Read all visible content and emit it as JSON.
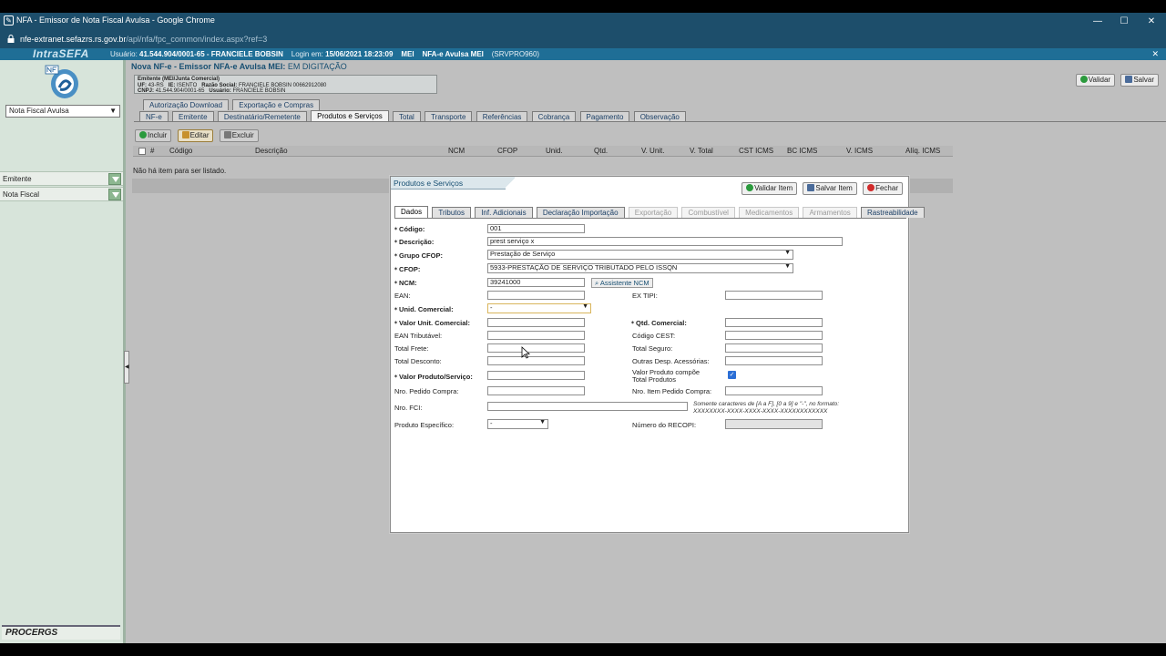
{
  "browser": {
    "window_title": "NFA - Emissor de Nota Fiscal Avulsa - Google Chrome",
    "url_host": "nfe-extranet.sefazrs.rs.gov.br",
    "url_path": "/apl/nfa/fpc_common/index.aspx?ref=3",
    "minimize": "—",
    "maximize": "☐",
    "close": "✕"
  },
  "topband": {
    "brand": "IntraSEFA",
    "user_label": "Usuário:",
    "user_value": "41.544.904/0001-65 - FRANCIELE BOBSIN",
    "login_label": "Login em:",
    "login_value": "15/06/2021 18:23:09",
    "profile1": "MEI",
    "profile2": "NFA-e Avulsa MEI",
    "server": "(SRVPRO960)",
    "close": "✕"
  },
  "sidebar": {
    "doc_type": "Nota Fiscal Avulsa",
    "items": [
      {
        "label": "Emitente"
      },
      {
        "label": "Nota Fiscal"
      }
    ],
    "footer_logo": "PROCERGS",
    "collapse": "◀"
  },
  "form": {
    "title_prefix": "Nova NF-e - Emissor NFA-e Avulsa MEI:",
    "title_status": "EM DIGITAÇÃO",
    "emitente": {
      "line1": "Emitente (MEI/Junta Comercial)",
      "uf_label": "UF:",
      "uf_value": "43-RS",
      "ie_label": "IE:",
      "ie_value": "ISENTO",
      "rs_label": "Razão Social:",
      "rs_value": "FRANCIELE BOBSIN 00662912080",
      "cnpj_label": "CNPJ:",
      "cnpj_value": "41.544.904/0001-65",
      "user_label": "Usuário:",
      "user_value": "FRANCIELE BOBSIN"
    },
    "validar": "Validar",
    "salvar": "Salvar",
    "subtabs": [
      "Autorização Download",
      "Exportação e Compras"
    ],
    "tabs": [
      "NF-e",
      "Emitente",
      "Destinatário/Remetente",
      "Produtos e Serviços",
      "Total",
      "Transporte",
      "Referências",
      "Cobrança",
      "Pagamento",
      "Observação"
    ],
    "list_actions": {
      "incluir": "Incluir",
      "editar": "Editar",
      "excluir": "Excluir"
    },
    "grid_columns": [
      "#",
      "Código",
      "Descrição",
      "NCM",
      "CFOP",
      "Unid.",
      "Qtd.",
      "V. Unit.",
      "V. Total",
      "CST ICMS",
      "BC ICMS",
      "V. ICMS",
      "Alíq. ICMS"
    ],
    "no_items": "Não há item para ser listado."
  },
  "modal": {
    "title": "Produtos e Serviços",
    "validar_item": "Validar Item",
    "salvar_item": "Salvar Item",
    "fechar": "Fechar",
    "tabs": [
      {
        "label": "Dados",
        "state": "active"
      },
      {
        "label": "Tributos",
        "state": "normal"
      },
      {
        "label": "Inf. Adicionais",
        "state": "normal"
      },
      {
        "label": "Declaração Importação",
        "state": "normal"
      },
      {
        "label": "Exportação",
        "state": "disabled"
      },
      {
        "label": "Combustível",
        "state": "disabled"
      },
      {
        "label": "Medicamentos",
        "state": "disabled"
      },
      {
        "label": "Armamentos",
        "state": "disabled"
      },
      {
        "label": "Rastreabilidade",
        "state": "normal"
      }
    ],
    "fields": {
      "codigo_label": "Código:",
      "codigo_value": "001",
      "descricao_label": "Descrição:",
      "descricao_value": "prest serviço x",
      "grupo_cfop_label": "Grupo CFOP:",
      "grupo_cfop_value": "Prestação de Serviço",
      "cfop_label": "CFOP:",
      "cfop_value": "5933-PRESTAÇÃO DE SERVIÇO TRIBUTADO PELO ISSQN",
      "ncm_label": "NCM:",
      "ncm_value": "39241000",
      "ncm_assist": "Assistente NCM",
      "ean_label": "EAN:",
      "ean_value": "",
      "ex_tipi_label": "EX TIPI:",
      "ex_tipi_value": "",
      "unid_label": "Unid. Comercial:",
      "unid_value": "-",
      "valor_unit_label": "Valor Unit. Comercial:",
      "valor_unit_value": "",
      "qtd_label": "Qtd. Comercial:",
      "qtd_value": "",
      "ean_trib_label": "EAN Tributável:",
      "ean_trib_value": "",
      "cest_label": "Código CEST:",
      "cest_value": "",
      "frete_label": "Total Frete:",
      "frete_value": "",
      "seguro_label": "Total Seguro:",
      "seguro_value": "",
      "desconto_label": "Total Desconto:",
      "desconto_value": "",
      "outras_label": "Outras Desp. Acessórias:",
      "outras_value": "",
      "valor_prod_label": "Valor Produto/Serviço:",
      "valor_prod_value": "",
      "compoe_label1": "Valor Produto compõe",
      "compoe_label2": "Total Produtos",
      "compoe_checked": true,
      "pedido_label": "Nro. Pedido Compra:",
      "pedido_value": "",
      "item_pedido_label": "Nro. Item Pedido Compra:",
      "item_pedido_value": "",
      "fci_label": "Nro. FCI:",
      "fci_value": "",
      "fci_hint1": "Somente caracteres de [A a F], [0 a 9] e \"-\", no formato:",
      "fci_hint2": "XXXXXXXX-XXXX-XXXX-XXXX-XXXXXXXXXXXX",
      "especifico_label": "Produto Específico:",
      "especifico_value": "-",
      "recopi_label": "Número do RECOPI:",
      "recopi_value": ""
    }
  },
  "colors": {
    "chrome_bar": "#1d4e6b",
    "band": "#1f6e96",
    "sidebar": "#d7e4da",
    "page": "#bfbfbf",
    "accent_text": "#174f72"
  }
}
